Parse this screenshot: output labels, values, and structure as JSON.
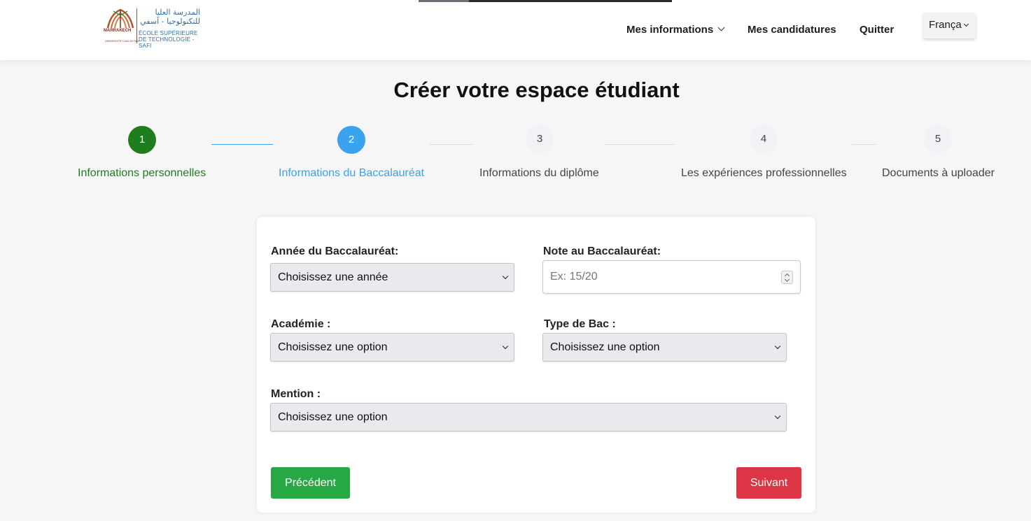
{
  "header": {
    "logo": {
      "arabic_line1": "المدرسة العليا",
      "arabic_line2": "للتكنولوجيا - آسفي",
      "french_line1": "ÉCOLE SUPÉRIEURE",
      "french_line2": "DE TECHNOLOGIE -SAFI",
      "city": "MARRAKECH",
      "university": "UNIVERSITÉ CADI AYYAD"
    },
    "nav": {
      "info": "Mes informations",
      "candidatures": "Mes candidatures",
      "quit": "Quitter"
    },
    "language": "França"
  },
  "page_title": "Créer votre espace étudiant",
  "steps": [
    {
      "number": "1",
      "label": "Informations personnelles",
      "status": "done"
    },
    {
      "number": "2",
      "label": "Informations du Baccalauréat",
      "status": "active"
    },
    {
      "number": "3",
      "label": "Informations du diplôme",
      "status": "todo"
    },
    {
      "number": "4",
      "label": "Les expériences professionnelles",
      "status": "todo"
    },
    {
      "number": "5",
      "label": "Documents à uploader",
      "status": "todo"
    }
  ],
  "form": {
    "annee": {
      "label": "Année du Baccalauréat:",
      "value": "Choisissez une année"
    },
    "note": {
      "label": "Note au Baccalauréat:",
      "placeholder": "Ex: 15/20"
    },
    "academie": {
      "label": "Académie :",
      "value": "Choisissez une option"
    },
    "type_bac": {
      "label": "Type de Bac :",
      "value": "Choisissez une option"
    },
    "mention": {
      "label": "Mention :",
      "value": "Choisissez une option"
    }
  },
  "buttons": {
    "previous": "Précédent",
    "next": "Suivant"
  },
  "colors": {
    "done": "#1e7e1e",
    "active": "#3aa2ef",
    "previous_button": "#28a745",
    "next_button": "#dc3545"
  }
}
